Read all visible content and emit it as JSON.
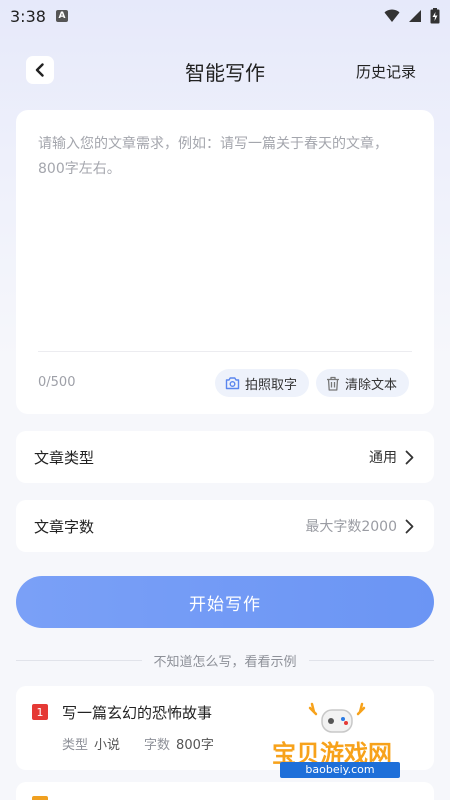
{
  "status": {
    "time": "3:38",
    "indicator": "A"
  },
  "header": {
    "title": "智能写作",
    "history_label": "历史记录"
  },
  "input": {
    "placeholder": "请输入您的文章需求，例如：请写一篇关于春天的文章，800字左右。",
    "counter": "0/500",
    "photo_label": "拍照取字",
    "clear_label": "清除文本"
  },
  "settings": {
    "type": {
      "label": "文章类型",
      "value": "通用"
    },
    "words": {
      "label": "文章字数",
      "value": "最大字数2000"
    }
  },
  "start_label": "开始写作",
  "examples_hint": "不知道怎么写，看看示例",
  "examples": [
    {
      "index": "1",
      "title": "写一篇玄幻的恐怖故事",
      "type_label": "类型",
      "type_value": "小说",
      "words_label": "字数",
      "words_value": "800字"
    }
  ],
  "watermark": {
    "text": "宝贝游戏网",
    "url": "baobeiy.com"
  },
  "colors": {
    "accent": "#6b95f4",
    "badge_red": "#e53935",
    "badge_orange": "#f0a020"
  }
}
